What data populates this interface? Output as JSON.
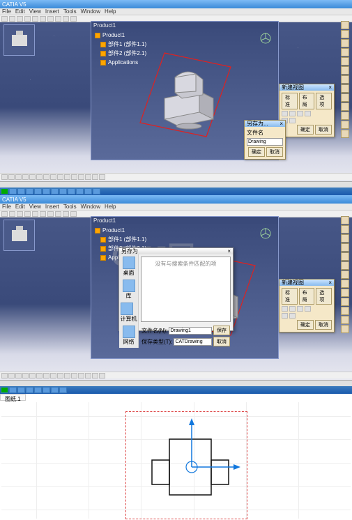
{
  "app_title": "CATIA V5",
  "menu": [
    "File",
    "Edit",
    "View",
    "Insert",
    "Tools",
    "Window",
    "Help"
  ],
  "viewport_title": "Product1",
  "tree": {
    "root": "Product1",
    "item1": "部件1 (部件1.1)",
    "item2": "部件2 (部件2.1)",
    "item3": "Applications"
  },
  "dialog1": {
    "title": "新建视图",
    "tab1": "标准",
    "tab2": "布局",
    "tab3": "选项",
    "btn_ok": "确定",
    "btn_cancel": "取消"
  },
  "dialog2": {
    "title": "另存为...",
    "label": "文件名",
    "field_value": "Drawing",
    "btn_ok": "确定",
    "btn_cancel": "取消"
  },
  "save_dialog": {
    "title": "另存为",
    "msg": "没有与搜索条件匹配的项",
    "side": {
      "i1": "桌面",
      "i2": "库",
      "i3": "计算机",
      "i4": "网络"
    },
    "label_name": "文件名(N):",
    "label_type": "保存类型(T):",
    "val_name": "Drawing1",
    "val_type": "CATDrawing",
    "btn_save": "保存",
    "btn_cancel": "取消"
  },
  "bottom_tab": "图纸.1"
}
